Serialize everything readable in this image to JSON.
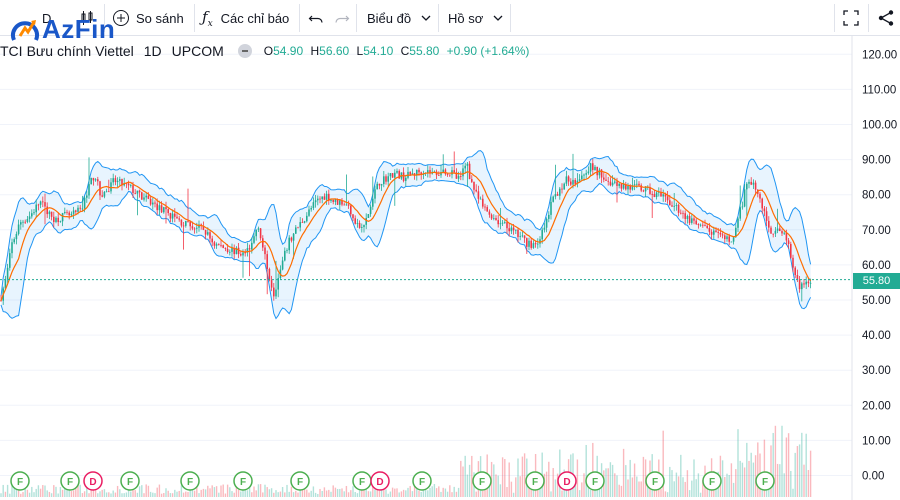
{
  "brand": {
    "logo_text": "AzFin"
  },
  "toolbar": {
    "compare_label": "So sánh",
    "indicators_label": "Các chỉ báo",
    "chart_label": "Biểu đồ",
    "profile_label": "Hồ sơ",
    "period_label": "D"
  },
  "legend": {
    "symbol": "TCI",
    "name": "Bưu chính Viettel",
    "interval": "1D",
    "exchange": "UPCOM",
    "open_label": "O",
    "open": "54.90",
    "high_label": "H",
    "high": "56.60",
    "low_label": "L",
    "low": "54.10",
    "close_label": "C",
    "close": "55.80",
    "change": "+0.90 (+1.64%)"
  },
  "price_tag": "55.80",
  "colors": {
    "up": "#22ab94",
    "down": "#f23645",
    "ma": "#ff6d00",
    "band": "#2196f3",
    "band_fill": "rgba(33,150,243,0.10)",
    "grid": "#f0f3fa",
    "axis_text": "#131722",
    "marker_f": "#4caf50",
    "marker_d": "#e91e63"
  },
  "chart_data": {
    "type": "candlestick",
    "y_ticks": [
      "120.00",
      "110.00",
      "100.00",
      "90.00",
      "80.00",
      "70.00",
      "60.00",
      "50.00",
      "40.00",
      "30.00",
      "20.00",
      "10.00",
      "0.00"
    ],
    "y_range": [
      0,
      120
    ],
    "last_price": 55.8,
    "indicators": [
      "Bollinger Bands",
      "Moving Average"
    ],
    "price_path": [
      [
        0,
        50
      ],
      [
        6,
        56
      ],
      [
        12,
        66
      ],
      [
        20,
        72
      ],
      [
        30,
        74
      ],
      [
        40,
        78
      ],
      [
        50,
        74
      ],
      [
        56,
        73
      ],
      [
        64,
        74
      ],
      [
        72,
        74
      ],
      [
        82,
        76
      ],
      [
        88,
        82
      ],
      [
        95,
        86
      ],
      [
        100,
        80
      ],
      [
        108,
        81
      ],
      [
        114,
        84
      ],
      [
        122,
        83
      ],
      [
        130,
        82
      ],
      [
        138,
        80
      ],
      [
        150,
        78
      ],
      [
        160,
        76
      ],
      [
        172,
        74
      ],
      [
        182,
        72
      ],
      [
        192,
        71
      ],
      [
        204,
        70
      ],
      [
        214,
        66
      ],
      [
        224,
        65
      ],
      [
        234,
        64
      ],
      [
        244,
        63
      ],
      [
        252,
        66
      ],
      [
        258,
        72
      ],
      [
        262,
        66
      ],
      [
        268,
        58
      ],
      [
        274,
        52
      ],
      [
        280,
        58
      ],
      [
        288,
        66
      ],
      [
        296,
        70
      ],
      [
        306,
        74
      ],
      [
        316,
        78
      ],
      [
        326,
        80
      ],
      [
        334,
        78
      ],
      [
        342,
        78
      ],
      [
        350,
        76
      ],
      [
        356,
        72
      ],
      [
        362,
        70
      ],
      [
        368,
        74
      ],
      [
        374,
        80
      ],
      [
        380,
        84
      ],
      [
        388,
        85
      ],
      [
        396,
        86
      ],
      [
        404,
        85
      ],
      [
        414,
        86
      ],
      [
        424,
        87
      ],
      [
        434,
        86
      ],
      [
        444,
        87
      ],
      [
        452,
        86
      ],
      [
        460,
        84
      ],
      [
        466,
        90
      ],
      [
        470,
        85
      ],
      [
        476,
        80
      ],
      [
        484,
        76
      ],
      [
        492,
        74
      ],
      [
        500,
        72
      ],
      [
        510,
        70
      ],
      [
        520,
        68
      ],
      [
        528,
        66
      ],
      [
        536,
        66
      ],
      [
        544,
        70
      ],
      [
        552,
        78
      ],
      [
        560,
        82
      ],
      [
        566,
        84
      ],
      [
        574,
        84
      ],
      [
        582,
        86
      ],
      [
        590,
        88
      ],
      [
        600,
        86
      ],
      [
        608,
        84
      ],
      [
        618,
        83
      ],
      [
        628,
        82
      ],
      [
        638,
        82
      ],
      [
        648,
        81
      ],
      [
        658,
        80
      ],
      [
        668,
        78
      ],
      [
        678,
        76
      ],
      [
        688,
        73
      ],
      [
        698,
        71
      ],
      [
        708,
        70
      ],
      [
        718,
        68
      ],
      [
        728,
        67
      ],
      [
        734,
        68
      ],
      [
        740,
        75
      ],
      [
        746,
        82
      ],
      [
        752,
        84
      ],
      [
        758,
        80
      ],
      [
        764,
        75
      ],
      [
        770,
        70
      ],
      [
        776,
        69
      ],
      [
        782,
        70
      ],
      [
        788,
        66
      ],
      [
        794,
        58
      ],
      [
        800,
        54
      ],
      [
        806,
        54
      ],
      [
        812,
        55.8
      ]
    ],
    "markers": [
      {
        "x": 20,
        "label": "F"
      },
      {
        "x": 70,
        "label": "F"
      },
      {
        "x": 93,
        "label": "D"
      },
      {
        "x": 130,
        "label": "F"
      },
      {
        "x": 190,
        "label": "F"
      },
      {
        "x": 243,
        "label": "F"
      },
      {
        "x": 300,
        "label": "F"
      },
      {
        "x": 362,
        "label": "F"
      },
      {
        "x": 380,
        "label": "D"
      },
      {
        "x": 422,
        "label": "F"
      },
      {
        "x": 482,
        "label": "F"
      },
      {
        "x": 535,
        "label": "F"
      },
      {
        "x": 567,
        "label": "D"
      },
      {
        "x": 595,
        "label": "F"
      },
      {
        "x": 655,
        "label": "F"
      },
      {
        "x": 712,
        "label": "F"
      },
      {
        "x": 765,
        "label": "F"
      }
    ]
  }
}
